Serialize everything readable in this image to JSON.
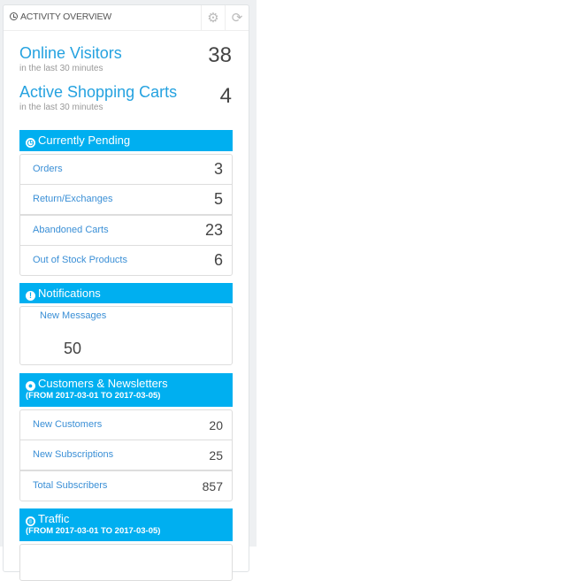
{
  "panel": {
    "title": "Activity Overview",
    "header_buttons": [
      {
        "name": "configure",
        "icon": "gear-icon",
        "glyph": "⚙"
      },
      {
        "name": "refresh",
        "icon": "refresh-icon",
        "glyph": "⟳"
      }
    ]
  },
  "live": [
    {
      "label": "Online Visitors",
      "sub": "in the last 30 minutes",
      "value": "38"
    },
    {
      "label": "Active Shopping Carts",
      "sub": "in the last 30 minutes",
      "value": "4"
    }
  ],
  "pending": {
    "title": "Currently Pending",
    "icon": "clock-icon",
    "items": [
      {
        "label": "Orders",
        "value": "3"
      },
      {
        "label": "Return/Exchanges",
        "value": "5"
      },
      {
        "label": "Abandoned Carts",
        "value": "23"
      },
      {
        "label": "Out of Stock Products",
        "value": "6"
      }
    ]
  },
  "notifications": {
    "title": "Notifications",
    "icon": "exclamation-icon",
    "label": "New Messages",
    "value": "50"
  },
  "customers": {
    "title": "Customers & Newsletters",
    "icon": "user-icon",
    "date_range": "(FROM 2017-03-01 TO 2017-03-05)",
    "items": [
      {
        "label": "New Customers",
        "value": "20"
      },
      {
        "label": "New Subscriptions",
        "value": "25"
      },
      {
        "label": "Total Subscribers",
        "value": "857"
      }
    ]
  },
  "traffic": {
    "title": "Traffic",
    "icon": "globe-icon",
    "date_range": "(FROM 2017-03-01 TO 2017-03-05)"
  }
}
